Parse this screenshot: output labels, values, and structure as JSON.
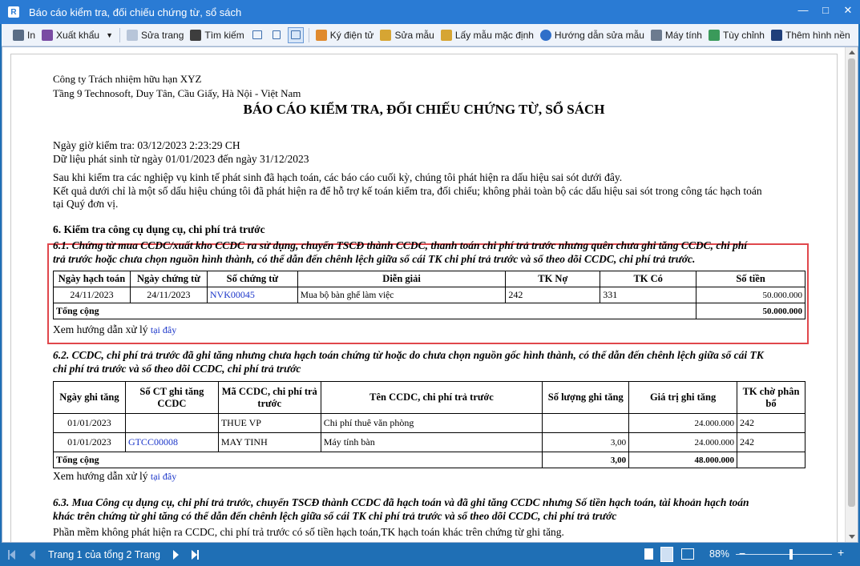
{
  "window": {
    "title": "Báo cáo kiểm tra, đối chiếu chứng từ, sổ sách",
    "app_icon": "report-app-icon"
  },
  "toolbar": {
    "print": "In",
    "export": "Xuất khẩu",
    "edit_template": "Sửa trang",
    "find": "Tìm kiếm",
    "sign": "Ký điện tử",
    "edit_form": "Sửa mẫu",
    "default_form": "Lấy mẫu mặc định",
    "guide": "Hướng dẫn sửa mẫu",
    "calculator": "Máy tính",
    "customize": "Tùy chỉnh",
    "add_background": "Thêm hình nền"
  },
  "report": {
    "company": "Công ty Trách nhiệm hữu hạn XYZ",
    "address": "Tầng 9 Technosoft, Duy Tân, Cầu Giấy, Hà Nội - Việt Nam",
    "title": "BÁO CÁO KIỂM TRA, ĐỐI CHIẾU CHỨNG TỪ, SỔ SÁCH",
    "check_time": "Ngày giờ kiểm tra: 03/12/2023 2:23:29 CH",
    "data_range": "Dữ liệu phát sinh từ ngày 01/01/2023 đến ngày 31/12/2023",
    "intro_1": "Sau khi kiểm tra các nghiệp vụ kinh tế phát sinh đã hạch toán, các báo cáo cuối kỳ, chúng tôi phát hiện ra dấu hiệu sai sót dưới đây.",
    "intro_2": "Kết quả dưới chỉ là một số dấu hiệu chúng tôi đã phát hiện ra để hỗ trợ kế toán kiểm tra, đối chiếu; không phải toàn bộ các dấu hiệu sai sót trong công tác hạch toán",
    "intro_3": "tại Quý đơn vị.",
    "section6": "6. Kiểm tra công cụ dụng cụ, chi phí trả trước",
    "s61_line1": "6.1. Chứng từ mua CCDC/xuất kho CCDC ra sử dụng, chuyển TSCĐ thành CCDC, thanh toán chi phí trả trước nhưng quên chưa ghi tăng CCDC, chi phí",
    "s61_line2": "trả trước hoặc chưa chọn nguồn hình thành, có thể dẫn đến chênh lệch giữa sổ cái TK chi phí trả trước và sổ theo dõi CCDC, chi phí trả trước.",
    "t1": {
      "headers": [
        "Ngày hạch toán",
        "Ngày chứng từ",
        "Số chứng từ",
        "Diễn giải",
        "TK Nợ",
        "TK Có",
        "Số tiền"
      ],
      "rows": [
        {
          "posting_date": "24/11/2023",
          "doc_date": "24/11/2023",
          "doc_no": "NVK00045",
          "desc": "Mua bộ bàn ghế làm việc",
          "debit": "242",
          "credit": "331",
          "amount": "50.000.000"
        }
      ],
      "total_label": "Tổng cộng",
      "total_amount": "50.000.000"
    },
    "guide_label": "Xem hướng dẫn xử lý",
    "guide_link": "tại đây",
    "s62_line1": "6.2. CCDC, chi phí trả trước đã ghi tăng nhưng chưa hạch toán chứng từ hoặc do chưa chọn nguồn gốc hình thành, có thể dẫn đến chênh lệch giữa sổ cái TK",
    "s62_line2": "chi phí trả trước và sổ theo dõi CCDC, chi phí trả trước",
    "t2": {
      "headers": [
        "Ngày ghi tăng",
        "Số CT ghi tăng CCDC",
        "Mã CCDC, chi phí trả trước",
        "Tên CCDC, chi phí trả trước",
        "Số lượng ghi tăng",
        "Giá trị ghi tăng",
        "TK chờ phân bổ"
      ],
      "rows": [
        {
          "date": "01/01/2023",
          "doc_no": "",
          "code": "THUE VP",
          "name": "Chi phí thuê văn phòng",
          "qty": "",
          "value": "24.000.000",
          "account": "242"
        },
        {
          "date": "01/01/2023",
          "doc_no": "GTCC00008",
          "code": "MAY TINH",
          "name": "Máy tính bàn",
          "qty": "3,00",
          "value": "24.000.000",
          "account": "242"
        }
      ],
      "total_label": "Tổng cộng",
      "total_qty": "3,00",
      "total_value": "48.000.000"
    },
    "s63_line1": "6.3. Mua Công cụ dụng cụ, chi phí trả trước, chuyển TSCĐ thành CCDC đã hạch toán và đã ghi tăng CCDC nhưng Số tiền hạch toán, tài khoản hạch toán",
    "s63_line2": "khác trên chứng từ ghi tăng có thể dẫn đến chênh lệch giữa sổ cái TK chi phí trả trước và sổ theo dõi CCDC, chi phí trả trước",
    "s63_result": "Phần mềm không phát hiện ra CCDC, chi phí trả trước có số tiền hạch toán,TK hạch toán khác trên chứng từ ghi tăng."
  },
  "status": {
    "page_info": "Trang 1 của tổng 2 Trang",
    "zoom": "88%"
  }
}
